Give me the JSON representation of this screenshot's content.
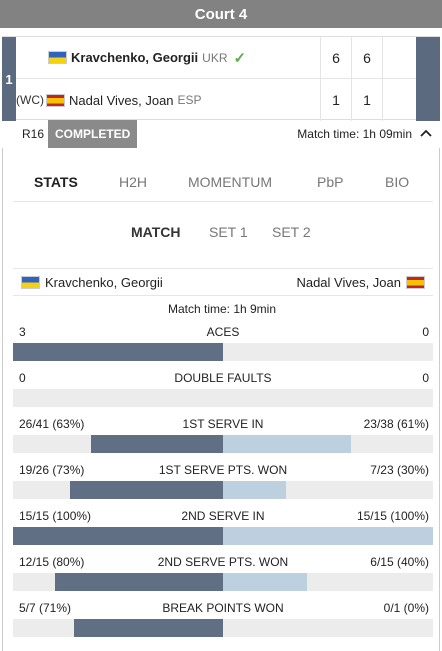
{
  "court": "Court 4",
  "match_number": "1",
  "players": [
    {
      "seed": "",
      "name": "Kravchenko, Georgii",
      "country": "UKR",
      "winner": true,
      "sets": [
        "6",
        "6"
      ]
    },
    {
      "seed": "(WC)",
      "name": "Nadal Vives, Joan",
      "country": "ESP",
      "winner": false,
      "sets": [
        "1",
        "1"
      ]
    }
  ],
  "round": "R16",
  "status": "COMPLETED",
  "match_time_header": "Match time: 1h 09min",
  "tabs": [
    "STATS",
    "H2H",
    "MOMENTUM",
    "PbP",
    "BIO"
  ],
  "active_tab": "STATS",
  "subtabs": [
    "MATCH",
    "SET 1",
    "SET 2"
  ],
  "active_subtab": "MATCH",
  "stats_players": {
    "left": "Kravchenko, Georgii",
    "right": "Nadal Vives, Joan"
  },
  "match_time_stats": "Match time: 1h 9min",
  "colors": {
    "header": "#828282",
    "bar_left": "#616f84",
    "bar_right": "#bcd0e0",
    "check": "#5ab04a"
  },
  "stats": [
    {
      "label": "ACES",
      "left": "3",
      "right": "0",
      "left_frac": 1.0,
      "right_frac": 0.0
    },
    {
      "label": "DOUBLE FAULTS",
      "left": "0",
      "right": "0",
      "left_frac": 0.0,
      "right_frac": 0.0
    },
    {
      "label": "1ST SERVE IN",
      "left": "26/41 (63%)",
      "right": "23/38 (61%)",
      "left_frac": 0.63,
      "right_frac": 0.61
    },
    {
      "label": "1ST SERVE PTS. WON",
      "left": "19/26 (73%)",
      "right": "7/23 (30%)",
      "left_frac": 0.73,
      "right_frac": 0.3
    },
    {
      "label": "2ND SERVE IN",
      "left": "15/15 (100%)",
      "right": "15/15 (100%)",
      "left_frac": 1.0,
      "right_frac": 1.0
    },
    {
      "label": "2ND SERVE PTS. WON",
      "left": "12/15 (80%)",
      "right": "6/15 (40%)",
      "left_frac": 0.8,
      "right_frac": 0.4
    },
    {
      "label": "BREAK POINTS WON",
      "left": "5/7 (71%)",
      "right": "0/1 (0%)",
      "left_frac": 0.71,
      "right_frac": 0.0
    }
  ]
}
